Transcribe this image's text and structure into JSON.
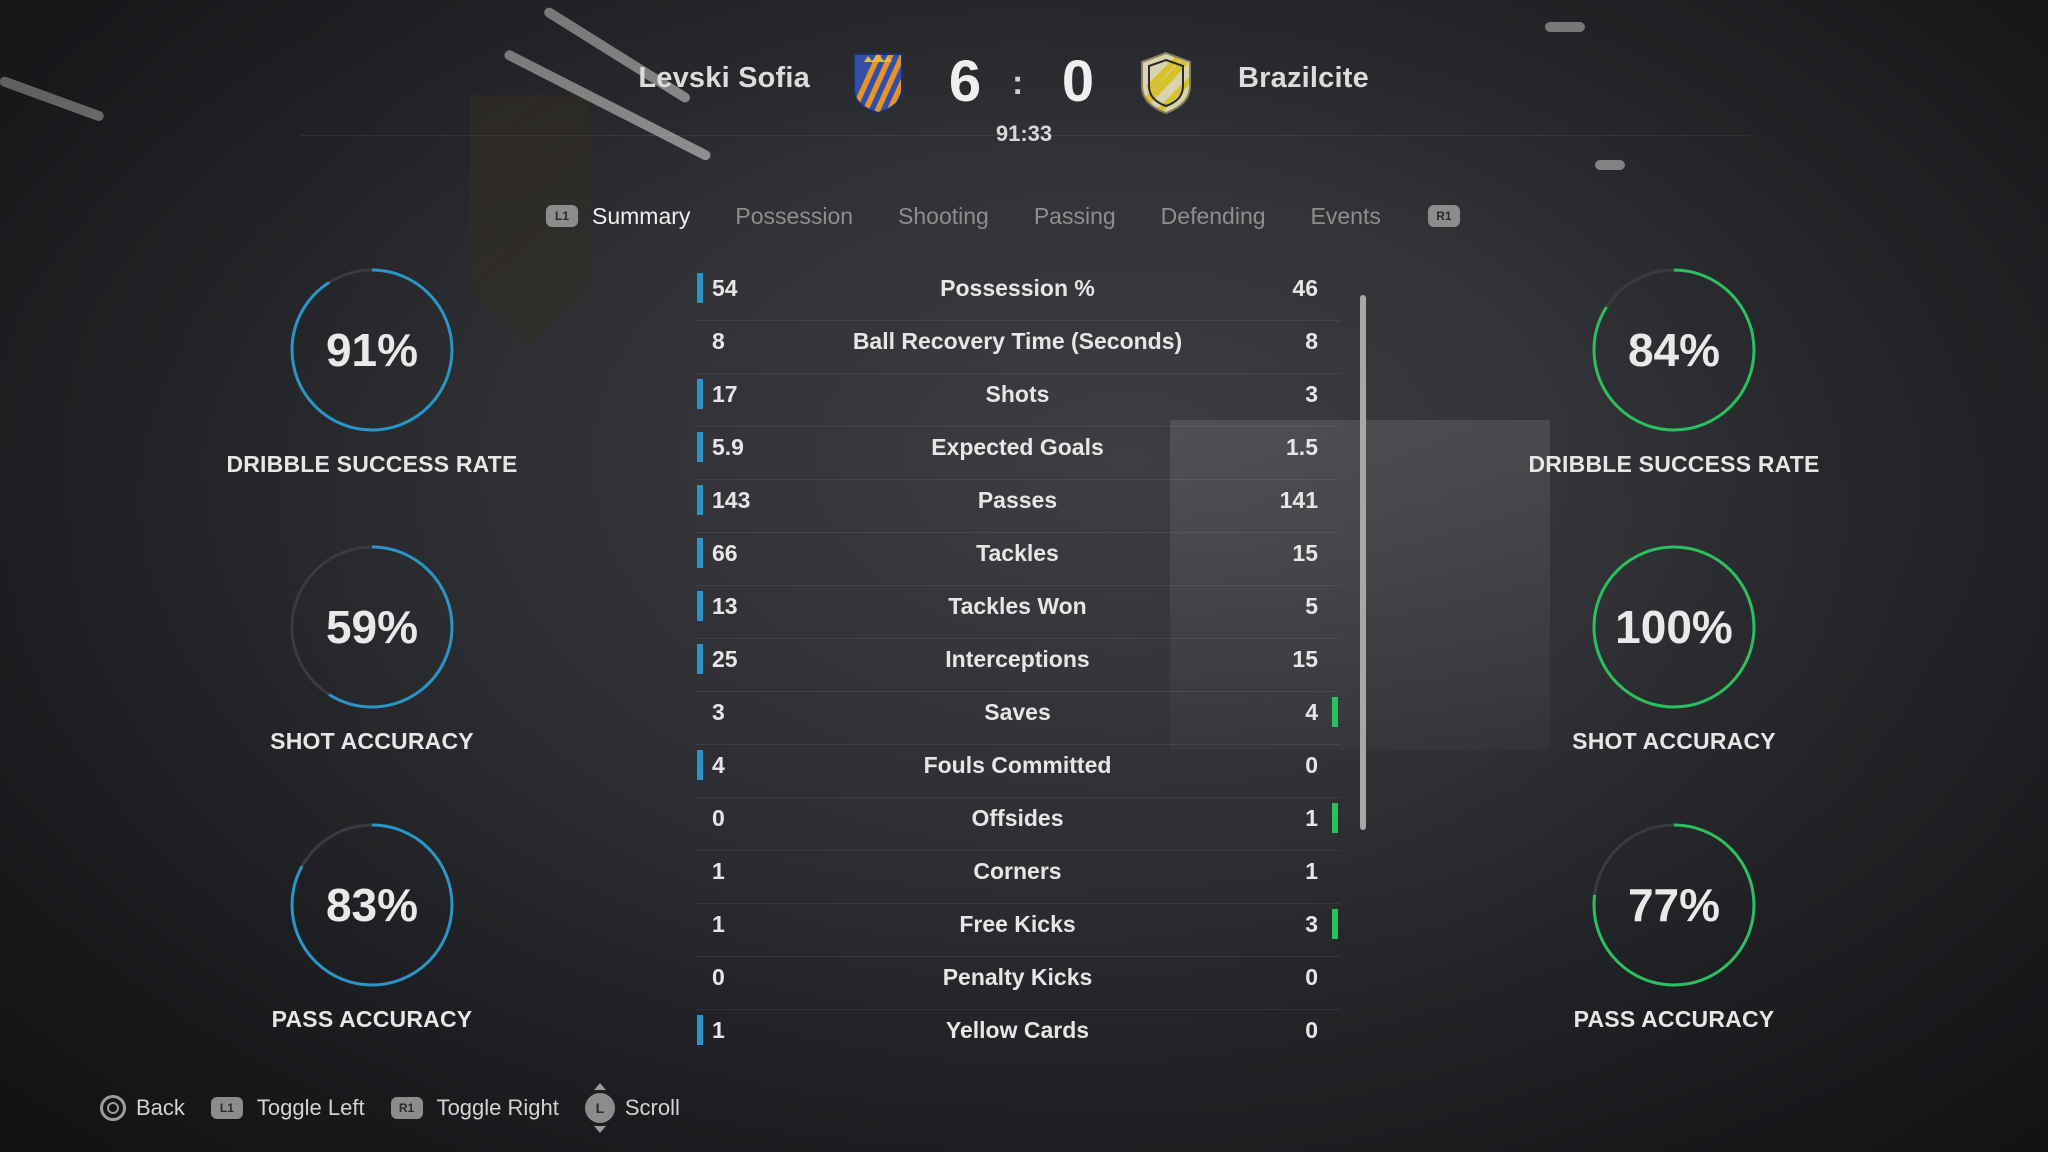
{
  "match": {
    "home_team": "Levski Sofia",
    "away_team": "Brazilcite",
    "home_score": "6",
    "away_score": "0",
    "separator": ":",
    "clock": "91:33"
  },
  "colors": {
    "home_accent": "#2a95c9",
    "away_accent": "#2bbf5f"
  },
  "tabs": {
    "left_button": "L1",
    "right_button": "R1",
    "items": [
      {
        "label": "Summary",
        "active": true
      },
      {
        "label": "Possession",
        "active": false
      },
      {
        "label": "Shooting",
        "active": false
      },
      {
        "label": "Passing",
        "active": false
      },
      {
        "label": "Defending",
        "active": false
      },
      {
        "label": "Events",
        "active": false
      }
    ]
  },
  "stats": [
    {
      "label": "Possession %",
      "home": "54",
      "away": "46",
      "leader": "home"
    },
    {
      "label": "Ball Recovery Time (Seconds)",
      "home": "8",
      "away": "8",
      "leader": "none"
    },
    {
      "label": "Shots",
      "home": "17",
      "away": "3",
      "leader": "home"
    },
    {
      "label": "Expected Goals",
      "home": "5.9",
      "away": "1.5",
      "leader": "home"
    },
    {
      "label": "Passes",
      "home": "143",
      "away": "141",
      "leader": "home"
    },
    {
      "label": "Tackles",
      "home": "66",
      "away": "15",
      "leader": "home"
    },
    {
      "label": "Tackles Won",
      "home": "13",
      "away": "5",
      "leader": "home"
    },
    {
      "label": "Interceptions",
      "home": "25",
      "away": "15",
      "leader": "home"
    },
    {
      "label": "Saves",
      "home": "3",
      "away": "4",
      "leader": "away"
    },
    {
      "label": "Fouls Committed",
      "home": "4",
      "away": "0",
      "leader": "home"
    },
    {
      "label": "Offsides",
      "home": "0",
      "away": "1",
      "leader": "away"
    },
    {
      "label": "Corners",
      "home": "1",
      "away": "1",
      "leader": "none"
    },
    {
      "label": "Free Kicks",
      "home": "1",
      "away": "3",
      "leader": "away"
    },
    {
      "label": "Penalty Kicks",
      "home": "0",
      "away": "0",
      "leader": "none"
    },
    {
      "label": "Yellow Cards",
      "home": "1",
      "away": "0",
      "leader": "home"
    }
  ],
  "home_rings": [
    {
      "value_text": "91%",
      "fraction": 0.91,
      "label": "DRIBBLE SUCCESS RATE"
    },
    {
      "value_text": "59%",
      "fraction": 0.59,
      "label": "SHOT ACCURACY"
    },
    {
      "value_text": "83%",
      "fraction": 0.83,
      "label": "PASS ACCURACY"
    }
  ],
  "away_rings": [
    {
      "value_text": "84%",
      "fraction": 0.84,
      "label": "DRIBBLE SUCCESS RATE"
    },
    {
      "value_text": "100%",
      "fraction": 1.0,
      "label": "SHOT ACCURACY"
    },
    {
      "value_text": "77%",
      "fraction": 0.77,
      "label": "PASS ACCURACY"
    }
  ],
  "footer": {
    "back": "Back",
    "toggle_left_button": "L1",
    "toggle_left": "Toggle Left",
    "toggle_right_button": "R1",
    "toggle_right": "Toggle Right",
    "scroll_button": "L",
    "scroll": "Scroll"
  },
  "scroll": {
    "visible_fraction": 1.0
  }
}
